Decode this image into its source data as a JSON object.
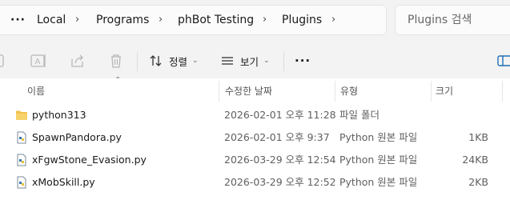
{
  "address_bar": {
    "more_label": "···",
    "crumbs": [
      "Local",
      "Programs",
      "phBot Testing",
      "Plugins"
    ],
    "separator": "›"
  },
  "search": {
    "placeholder": "Plugins 검색"
  },
  "toolbar": {
    "sort_label": "정렬",
    "view_label": "보기",
    "more_label": "···"
  },
  "columns": {
    "name": "이름",
    "modified": "수정한 날짜",
    "type": "유형",
    "size": "크기"
  },
  "files": [
    {
      "name": "python313",
      "modified": "2026-02-01 오후 11:28",
      "type": "파일 폴더",
      "size": "",
      "icon": "folder-icon"
    },
    {
      "name": "SpawnPandora.py",
      "modified": "2026-02-01 오후 9:37",
      "type": "Python 원본 파일",
      "size": "1KB",
      "icon": "python-file-icon"
    },
    {
      "name": "xFgwStone_Evasion.py",
      "modified": "2026-03-29 오후 12:54",
      "type": "Python 원본 파일",
      "size": "24KB",
      "icon": "python-file-icon"
    },
    {
      "name": "xMobSkill.py",
      "modified": "2026-03-29 오후 12:52",
      "type": "Python 원본 파일",
      "size": "2KB",
      "icon": "python-file-icon"
    }
  ],
  "colors": {
    "folder": "#f2c14e",
    "accent": "#1f6fb5",
    "background": "#f3f3f3"
  }
}
